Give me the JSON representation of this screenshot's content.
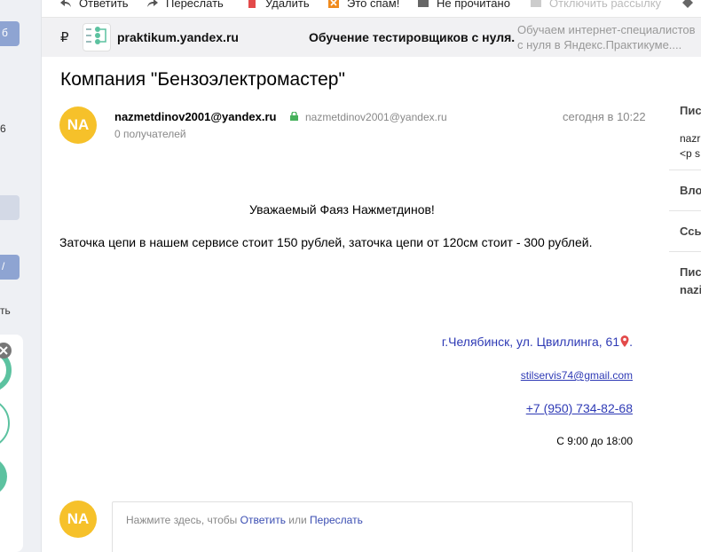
{
  "toolbar": {
    "reply": "Ответить",
    "forward": "Переслать",
    "delete": "Удалить",
    "spam": "Это спам!",
    "unread": "Не прочитано",
    "unsubscribe": "Отключить рассылку"
  },
  "left_sidebar": {
    "fragments": [
      "б",
      "6",
      "/",
      "ть"
    ]
  },
  "ad": {
    "ruble": "₽",
    "domain": "praktikum.yandex.ru",
    "title": "Обучение тестировщиков с нуля.",
    "description": "Обучаем интернет-специалистов с нуля в Яндекс.Практикуме...."
  },
  "message": {
    "subject": "Компания \"Бензоэлектромастер\"",
    "avatar_initials": "NA",
    "sender_name": "nazmetdinov2001@yandex.ru",
    "sender_email": "nazmetdinov2001@yandex.ru",
    "date": "сегодня в 10:22",
    "recipients": "0 получателей",
    "greeting": "Уважаемый Фаяз Нажметдинов!",
    "body": "Заточка цепи в нашем сервисе стоит 150 рублей, заточка цепи от 120см стоит - 300 рублей.",
    "address": "г.Челябинск, ул. Цвиллинга, 61",
    "address_end": ".",
    "email_link": "stilservis74@gmail.com",
    "phone": "+7 (950) 734-82-68",
    "hours": "С 9:00 до 18:00"
  },
  "reply": {
    "avatar_initials": "NA",
    "prefix": "Нажмите здесь, чтобы ",
    "reply_link": "Ответить",
    "or": " или ",
    "forward_link": "Переслать"
  },
  "right_panel": {
    "section1": "Пис",
    "line1": "nazr",
    "line2": "<p s",
    "section2": "Вло",
    "section3": "Ссь",
    "section4": "Пис",
    "line3": "nazi"
  },
  "colors": {
    "avatar": "#f6c12a",
    "link": "#2e3ab5",
    "sidebar": "#eef0f4",
    "adbar": "#f1f1f3"
  }
}
